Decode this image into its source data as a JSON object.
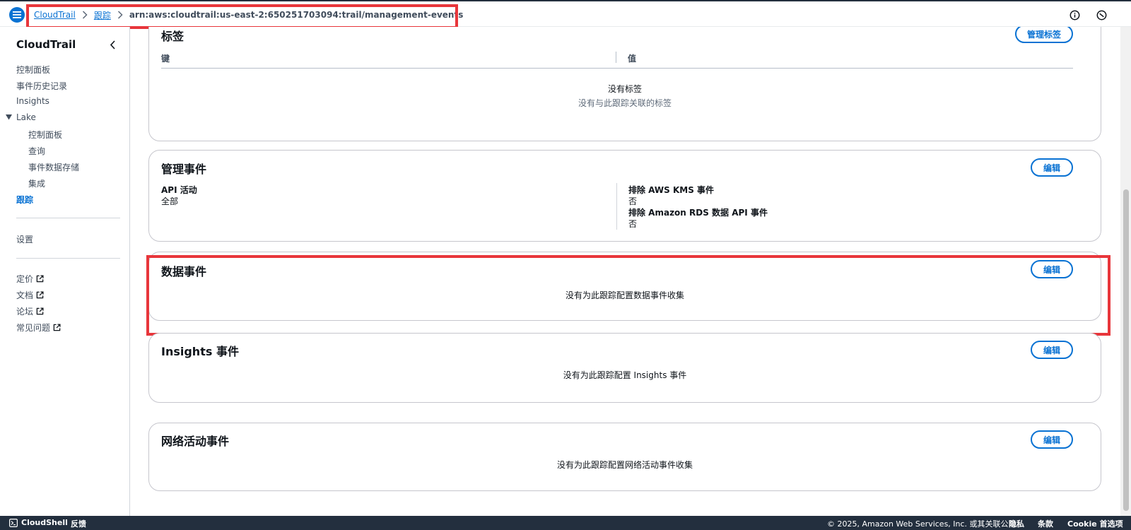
{
  "breadcrumb": {
    "items": [
      "CloudTrail",
      "跟踪"
    ],
    "current": "arn:aws:cloudtrail:us-east-2:650251703094:trail/management-events"
  },
  "icons": {
    "menu": "hamburger-menu-icon",
    "info": "info-icon",
    "notifications": "notifications-icon"
  },
  "sidebar": {
    "title": "CloudTrail",
    "items": {
      "dashboard": "控制面板",
      "event_history": "事件历史记录",
      "insights": "Insights",
      "lake": "Lake",
      "lake_dashboard": "控制面板",
      "query": "查询",
      "event_data_store": "事件数据存储",
      "integrations": "集成",
      "trails": "跟踪",
      "settings": "设置",
      "pricing": "定价",
      "docs": "文档",
      "forum": "论坛",
      "faq": "常见问题"
    }
  },
  "tags_card": {
    "title": "标签",
    "manage_button": "管理标签",
    "col_key": "键",
    "col_value": "值",
    "empty_title": "没有标签",
    "empty_desc": "没有与此跟踪关联的标签"
  },
  "mgmt_card": {
    "title": "管理事件",
    "edit_button": "编辑",
    "api_label": "API 活动",
    "api_value": "全部",
    "kms_label": "排除 AWS KMS 事件",
    "kms_value": "否",
    "rds_label": "排除 Amazon RDS 数据 API 事件",
    "rds_value": "否"
  },
  "data_card": {
    "title": "数据事件",
    "edit_button": "编辑",
    "empty": "没有为此跟踪配置数据事件收集"
  },
  "insights_card": {
    "title": "Insights 事件",
    "edit_button": "编辑",
    "empty": "没有为此跟踪配置 Insights 事件"
  },
  "network_card": {
    "title": "网络活动事件",
    "edit_button": "编辑",
    "empty": "没有为此跟踪配置网络活动事件收集"
  },
  "footer": {
    "cloudshell": "CloudShell",
    "feedback": "反馈",
    "copyright": "© 2025, Amazon Web Services, Inc. 或其关联公司。",
    "privacy": "隐私",
    "terms": "条款",
    "cookies": "Cookie 首选项"
  },
  "colors": {
    "accent": "#0972d3",
    "highlight": "#e8363b",
    "footer_bg": "#232f3e"
  }
}
